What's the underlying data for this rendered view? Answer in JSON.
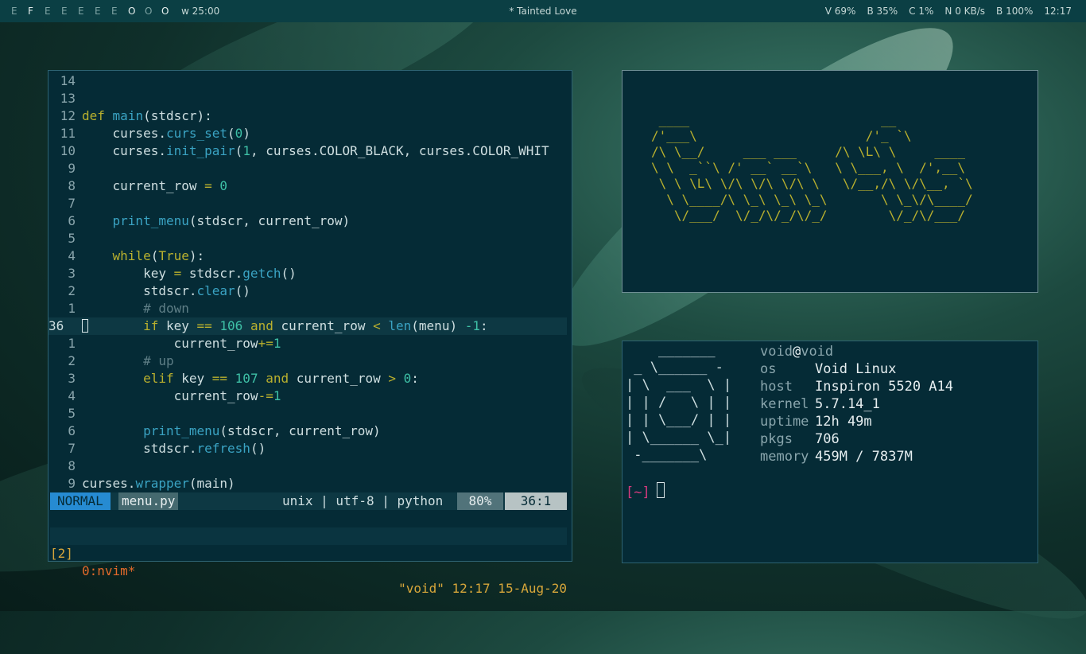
{
  "topbar": {
    "workspaces": [
      {
        "label": "E",
        "active": false
      },
      {
        "label": "F",
        "active": true
      },
      {
        "label": "E",
        "active": false
      },
      {
        "label": "E",
        "active": false
      },
      {
        "label": "E",
        "active": false
      },
      {
        "label": "E",
        "active": false
      },
      {
        "label": "E",
        "active": false
      },
      {
        "label": "O",
        "active": true
      },
      {
        "label": "O",
        "active": false
      },
      {
        "label": "O",
        "active": true
      }
    ],
    "timer": "w 25:00",
    "now_playing": "* Tainted Love",
    "stats": [
      "V 69%",
      "B 35%",
      "C 1%",
      "N 0 KB/s",
      "B 100%",
      "12:17"
    ]
  },
  "editor": {
    "lines": [
      {
        "n": "14",
        "code": ""
      },
      {
        "n": "13",
        "code": ""
      },
      {
        "n": "12",
        "code": "def main(stdscr):"
      },
      {
        "n": "11",
        "code": "    curses.curs_set(0)"
      },
      {
        "n": "10",
        "code": "    curses.init_pair(1, curses.COLOR_BLACK, curses.COLOR_WHIT"
      },
      {
        "n": "9",
        "code": ""
      },
      {
        "n": "8",
        "code": "    current_row = 0"
      },
      {
        "n": "7",
        "code": ""
      },
      {
        "n": "6",
        "code": "    print_menu(stdscr, current_row)"
      },
      {
        "n": "5",
        "code": ""
      },
      {
        "n": "4",
        "code": "    while(True):"
      },
      {
        "n": "3",
        "code": "        key = stdscr.getch()"
      },
      {
        "n": "2",
        "code": "        stdscr.clear()"
      },
      {
        "n": "1",
        "code": "        # down"
      },
      {
        "n": "36",
        "code": "        if key == 106 and current_row < len(menu) -1:"
      },
      {
        "n": "1",
        "code": "            current_row+=1"
      },
      {
        "n": "2",
        "code": "        # up"
      },
      {
        "n": "3",
        "code": "        elif key == 107 and current_row > 0:"
      },
      {
        "n": "4",
        "code": "            current_row-=1"
      },
      {
        "n": "5",
        "code": ""
      },
      {
        "n": "6",
        "code": "        print_menu(stdscr, current_row)"
      },
      {
        "n": "7",
        "code": "        stdscr.refresh()"
      },
      {
        "n": "8",
        "code": ""
      },
      {
        "n": "9",
        "code": "curses.wrapper(main)"
      }
    ],
    "status": {
      "mode": "NORMAL",
      "file": "menu.py",
      "info": "unix | utf-8 | python",
      "percent": "80%",
      "position": "36:1"
    },
    "tmux": {
      "index": "[2]",
      "window": "0:nvim*",
      "right": "\"void\" 12:17 15-Aug-20"
    }
  },
  "ascii_art": " ____                         __\n/'___\\                      /'_ `\\\n/\\ \\__/     ___ ___     /\\ \\L\\ \\     ____\n\\ \\  _``\\ /' __` __`\\   \\ \\___, \\  /',__\\\n \\ \\ \\L\\ \\/\\ \\/\\ \\/\\ \\   \\/__,/\\ \\/\\__, `\\\n  \\ \\____/\\ \\_\\ \\_\\ \\_\\       \\ \\_\\/\\____/\n   \\/___/  \\/_/\\/_/\\/_/        \\/_/\\/___/",
  "fetch": {
    "logo": "    _______\n _ \\______ -\n| \\  ___  \\ |\n| | /   \\ | |\n| | \\___/ | |\n| \\______ \\_|\n -_______\\",
    "user": "void",
    "host": "void",
    "rows": [
      {
        "key": "os",
        "value": "Void Linux"
      },
      {
        "key": "host",
        "value": "Inspiron 5520 A14"
      },
      {
        "key": "kernel",
        "value": "5.7.14_1"
      },
      {
        "key": "uptime",
        "value": "12h 49m"
      },
      {
        "key": "pkgs",
        "value": "706"
      },
      {
        "key": "memory",
        "value": "459M / 7837M"
      }
    ],
    "prompt": "[~]"
  }
}
